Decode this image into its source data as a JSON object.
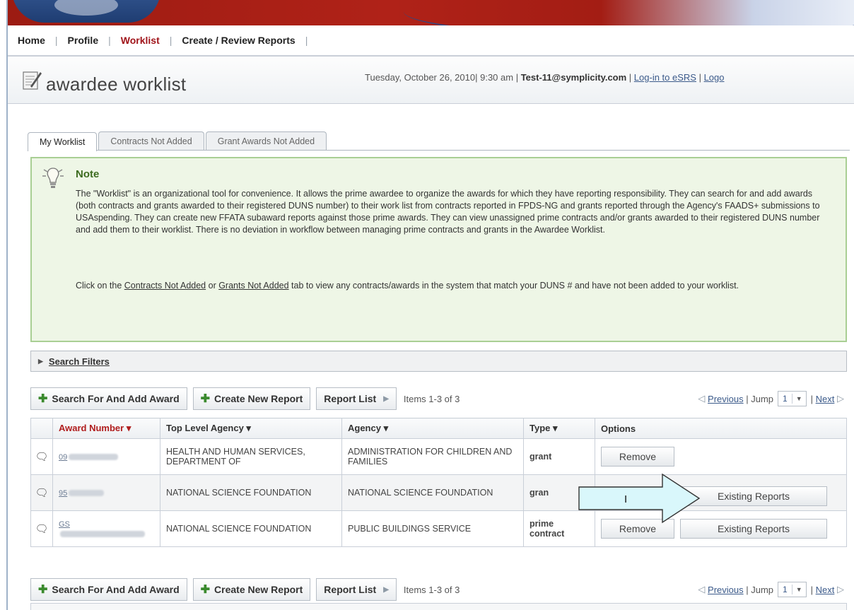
{
  "nav": {
    "items": [
      {
        "label": "Home",
        "active": false
      },
      {
        "label": "Profile",
        "active": false
      },
      {
        "label": "Worklist",
        "active": true
      },
      {
        "label": "Create / Review Reports",
        "active": false
      }
    ]
  },
  "header": {
    "title": "awardee worklist",
    "date": "Tuesday, October 26, 2010",
    "time": "9:30 am",
    "user": "Test-11@symplicity.com",
    "login_link": "Log-in to eSRS",
    "logout_link": "Logo"
  },
  "tabs": [
    {
      "label": "My Worklist",
      "active": true
    },
    {
      "label": "Contracts Not Added",
      "active": false
    },
    {
      "label": "Grant Awards Not Added",
      "active": false
    }
  ],
  "note": {
    "title": "Note",
    "paragraph1": "The \"Worklist\" is an organizational tool for convenience. It allows the prime awardee to organize the awards for which they have reporting responsibility. They can search for and add awards (both contracts and grants awarded to their registered DUNS number) to their work list from contracts reported in FPDS-NG and grants reported through the Agency's FAADS+ submissions to USAspending. They can create new FFATA subaward reports against those prime awards. They can view unassigned prime contracts and/or grants awarded to their registered DUNS number and add them to their worklist. There is no deviation in workflow between managing prime contracts and grants in the Awardee Worklist.",
    "p2_prefix": "Click on the ",
    "p2_link1": "Contracts Not Added",
    "p2_middle": " or ",
    "p2_link2": "Grants Not Added",
    "p2_suffix": " tab to view any contracts/awards in the system that match your DUNS # and have not been added to your worklist."
  },
  "search_filters": {
    "label": "Search Filters"
  },
  "toolbar": {
    "search_add_label": "Search For And Add Award",
    "create_report_label": "Create New Report",
    "report_list_label": "Report List",
    "items_text": "Items 1-3 of 3",
    "previous_label": "Previous",
    "jump_label": "Jump",
    "jump_value": "1",
    "next_label": "Next"
  },
  "table": {
    "headers": {
      "award_number": "Award Number ▾",
      "top_agency": "Top Level Agency ▾",
      "agency": "Agency ▾",
      "type": "Type ▾",
      "options": "Options"
    },
    "rows": [
      {
        "award_number": "09",
        "top_agency": "HEALTH AND HUMAN SERVICES, DEPARTMENT OF",
        "agency": "ADMINISTRATION FOR CHILDREN AND FAMILIES",
        "type": "grant",
        "remove": "Remove",
        "existing": ""
      },
      {
        "award_number": "95",
        "top_agency": "NATIONAL SCIENCE FOUNDATION",
        "agency": "NATIONAL SCIENCE FOUNDATION",
        "type": "gran",
        "remove": "",
        "existing": "Existing Reports"
      },
      {
        "award_number": "GS",
        "top_agency": "NATIONAL SCIENCE FOUNDATION",
        "agency": "PUBLIC BUILDINGS SERVICE",
        "type": "prime contract",
        "remove": "Remove",
        "existing": "Existing Reports"
      }
    ]
  },
  "callout": {
    "text": "I"
  },
  "colors": {
    "banner_red": "#a31d14",
    "active_nav": "#a0141a",
    "note_bg": "#eef6e6",
    "note_border": "#a9cf94",
    "add_green": "#3b8a2e",
    "callout_fill": "#d9f7fb"
  }
}
